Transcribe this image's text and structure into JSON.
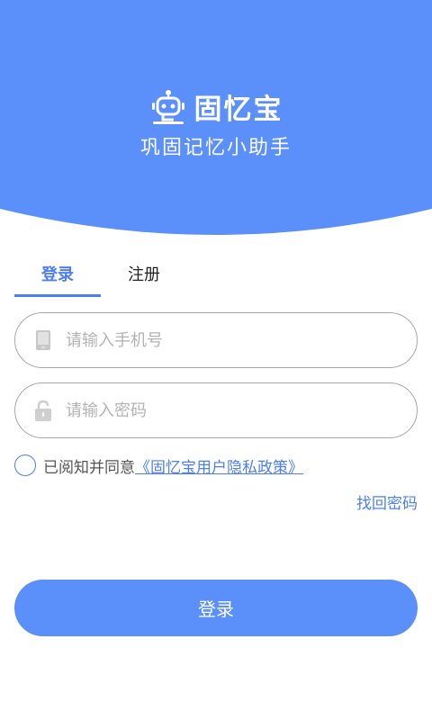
{
  "colors": {
    "primary": "#5b8ff9",
    "accent": "#4d7ff0",
    "border": "#a7a7a7",
    "placeholder": "#b3b3b3"
  },
  "header": {
    "logo_icon": "robot-icon",
    "app_name": "固忆宝",
    "slogan": "巩固记忆小助手"
  },
  "tabs": [
    {
      "label": "登录",
      "active": true
    },
    {
      "label": "注册",
      "active": false
    }
  ],
  "form": {
    "phone": {
      "icon": "phone-icon",
      "placeholder": "请输入手机号",
      "value": ""
    },
    "password": {
      "icon": "lock-icon",
      "placeholder": "请输入密码",
      "value": ""
    },
    "agreement": {
      "checked": false,
      "text": "已阅知并同意",
      "link": "《固忆宝用户隐私政策》"
    },
    "forgot_password": "找回密码",
    "submit_label": "登录"
  }
}
